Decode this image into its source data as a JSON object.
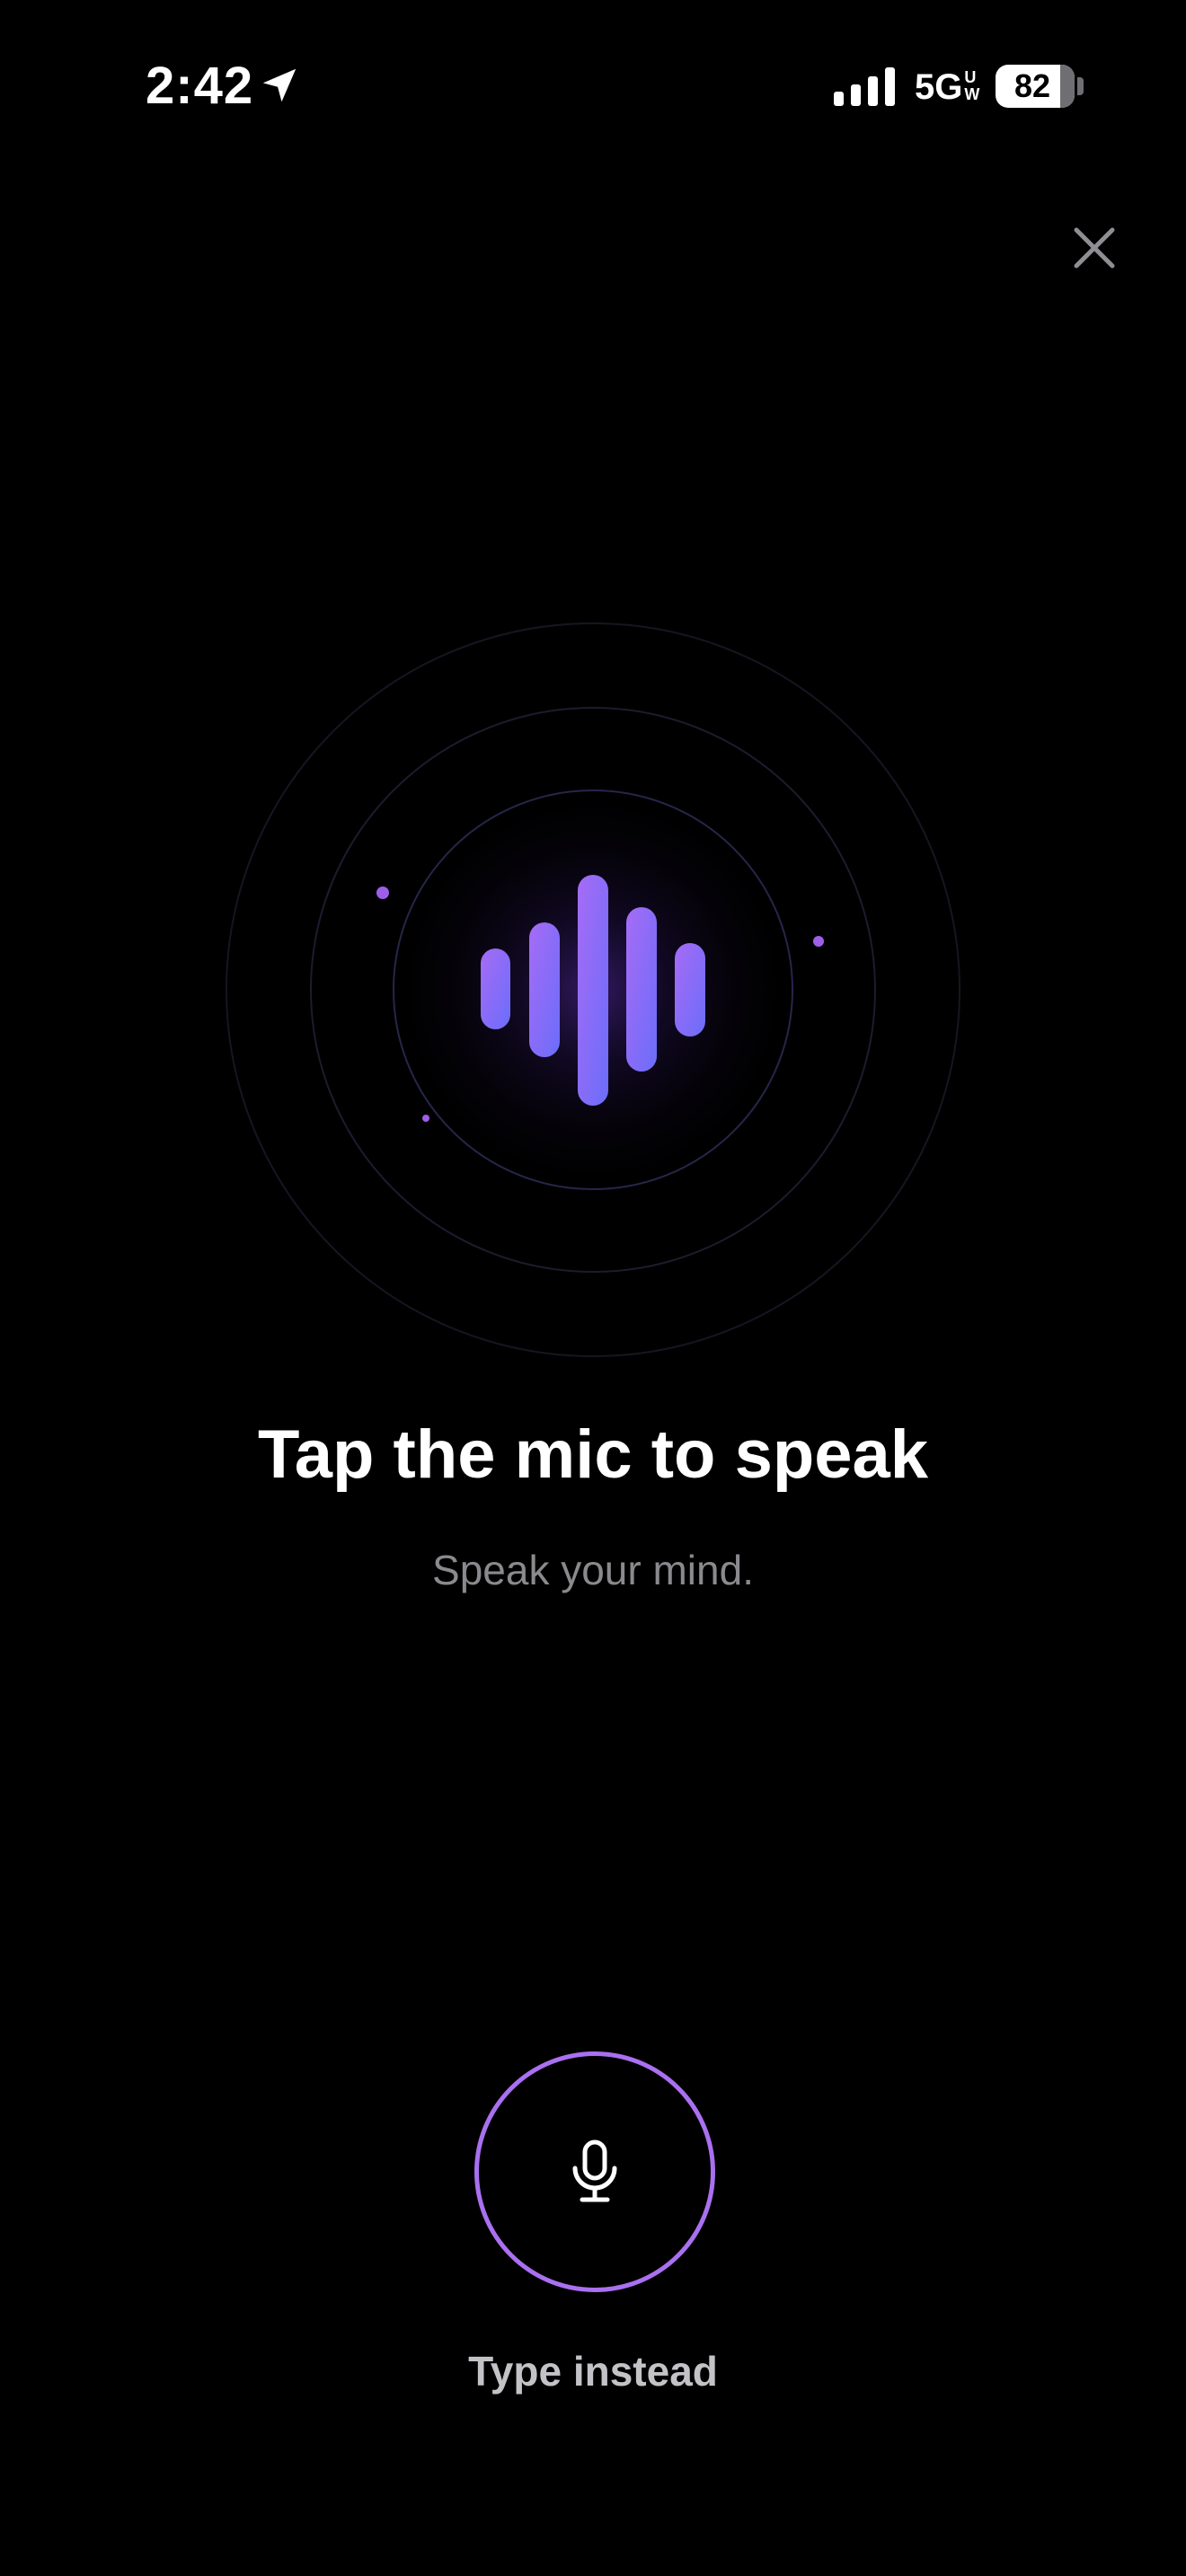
{
  "status_bar": {
    "time": "2:42",
    "network": "5G",
    "network_badge_top": "U",
    "network_badge_bottom": "W",
    "battery_level": 82,
    "battery_label": "82"
  },
  "icons": {
    "location": "location-arrow-icon",
    "signal": "cellular-signal-icon",
    "close": "close-icon",
    "waveform": "voice-waveform-icon",
    "mic": "microphone-icon"
  },
  "colors": {
    "background": "#000000",
    "accent": "#a970f0",
    "wave_gradient_start": "#a66cf5",
    "wave_gradient_end": "#6b6dfa",
    "subtitle": "#8a8a8e"
  },
  "main": {
    "title": "Tap the mic to speak",
    "subtitle": "Speak your mind."
  },
  "actions": {
    "type_instead_label": "Type instead"
  }
}
